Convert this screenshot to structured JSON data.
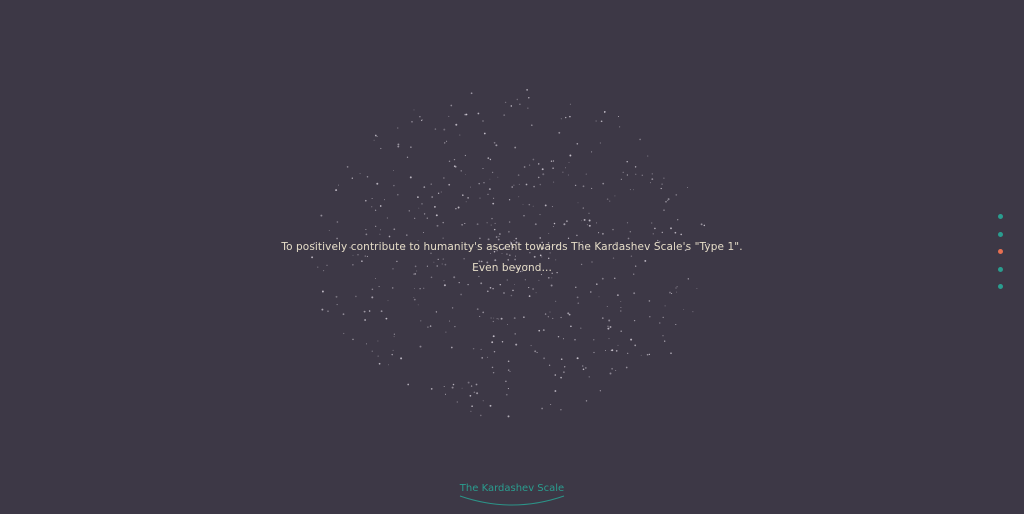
{
  "hero": {
    "line1": "To positively contribute to humanity's ascent towards The Kardashev Scale's \"Type 1\".",
    "line2": "Even beyond..."
  },
  "side_nav": {
    "dots": [
      {
        "color": "#2a9d8f",
        "active": false
      },
      {
        "color": "#2a9d8f",
        "active": false
      },
      {
        "color": "#e76f51",
        "active": true
      },
      {
        "color": "#2a9d8f",
        "active": false
      },
      {
        "color": "#2a9d8f",
        "active": false
      }
    ]
  },
  "footer": {
    "link_label": "The Kardashev Scale"
  },
  "colors": {
    "background": "#3d3846",
    "text": "#e6ddc8",
    "accent": "#2a9d8f",
    "active": "#e76f51",
    "particle": "#d8d2dc"
  }
}
